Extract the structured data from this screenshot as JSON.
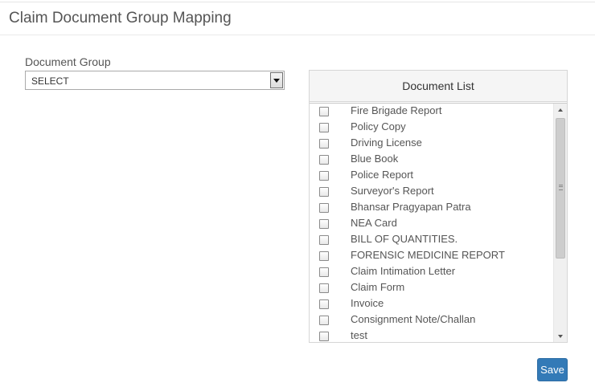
{
  "page": {
    "title": "Claim Document Group Mapping"
  },
  "form": {
    "document_group_label": "Document Group",
    "document_group_value": "SELECT"
  },
  "document_list": {
    "header": "Document List",
    "items": [
      {
        "label": "Fire Brigade Report",
        "checked": false
      },
      {
        "label": "Policy Copy",
        "checked": false
      },
      {
        "label": "Driving License",
        "checked": false
      },
      {
        "label": "Blue Book",
        "checked": false
      },
      {
        "label": "Police Report",
        "checked": false
      },
      {
        "label": "Surveyor's Report",
        "checked": false
      },
      {
        "label": "Bhansar Pragyapan Patra",
        "checked": false
      },
      {
        "label": "NEA Card",
        "checked": false
      },
      {
        "label": "BILL OF QUANTITIES.",
        "checked": false
      },
      {
        "label": "FORENSIC MEDICINE REPORT",
        "checked": false
      },
      {
        "label": "Claim Intimation Letter",
        "checked": false
      },
      {
        "label": "Claim Form",
        "checked": false
      },
      {
        "label": "Invoice",
        "checked": false
      },
      {
        "label": "Consignment Note/Challan",
        "checked": false
      },
      {
        "label": "test",
        "checked": false
      }
    ]
  },
  "actions": {
    "save_label": "Save"
  },
  "colors": {
    "primary_button": "#337ab7",
    "header_bg": "#f5f5f5"
  }
}
